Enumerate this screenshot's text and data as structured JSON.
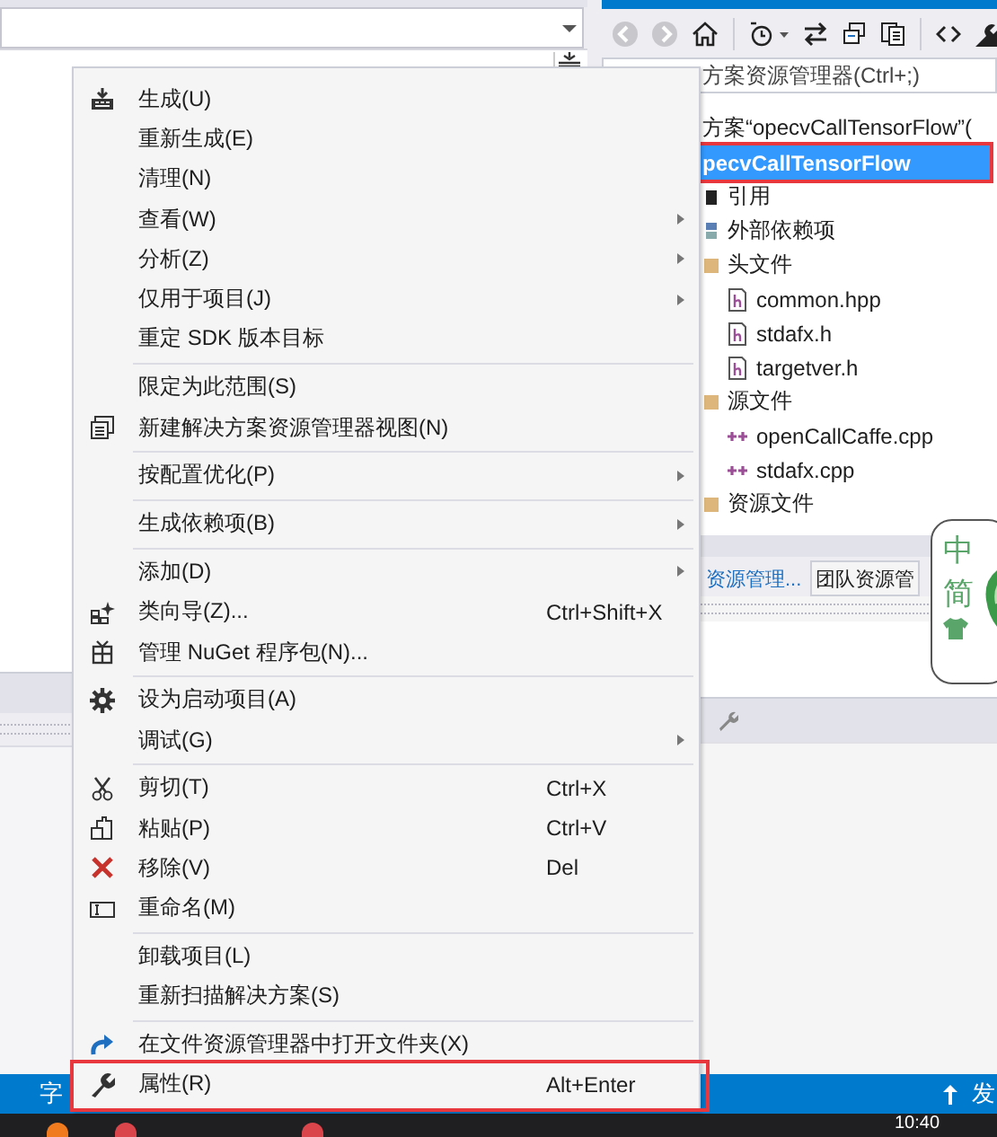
{
  "solution_explorer": {
    "search": {
      "placeholder": "方案资源管理器(Ctrl+;)"
    },
    "tree": [
      {
        "label": "方案“opecvCallTensorFlow”(",
        "selected": false,
        "children": [
          {
            "label": "pecvCallTensorFlow",
            "selected": true,
            "outlined": true,
            "children": [
              {
                "label": "引用",
                "kind": "references",
                "selected": false
              },
              {
                "label": "外部依赖项",
                "kind": "external",
                "selected": false
              },
              {
                "label": "头文件",
                "kind": "folder",
                "selected": false,
                "children": [
                  {
                    "label": "common.hpp",
                    "kind": "header",
                    "selected": false
                  },
                  {
                    "label": "stdafx.h",
                    "kind": "header",
                    "selected": false
                  },
                  {
                    "label": "targetver.h",
                    "kind": "header",
                    "selected": false
                  }
                ]
              },
              {
                "label": "源文件",
                "kind": "folder",
                "selected": false,
                "children": [
                  {
                    "label": "openCallCaffe.cpp",
                    "kind": "source",
                    "selected": false
                  },
                  {
                    "label": "stdafx.cpp",
                    "kind": "source",
                    "selected": false
                  }
                ]
              },
              {
                "label": "资源文件",
                "kind": "folder",
                "selected": false
              }
            ]
          }
        ]
      }
    ],
    "tabs": [
      {
        "label": "资源管理...",
        "selected": true
      },
      {
        "label": "团队资源管",
        "selected": false
      }
    ]
  },
  "ime_toolbar": {
    "items": [
      "中",
      "简"
    ]
  },
  "context_menu": {
    "items": [
      {
        "kind": "item",
        "label": "生成(U)"
      },
      {
        "kind": "item",
        "label": "重新生成(E)"
      },
      {
        "kind": "item",
        "label": "清理(N)"
      },
      {
        "kind": "item",
        "label": "查看(W)",
        "submenu": true
      },
      {
        "kind": "item",
        "label": "分析(Z)",
        "submenu": true
      },
      {
        "kind": "item",
        "label": "仅用于项目(J)",
        "submenu": true
      },
      {
        "kind": "item",
        "label": "重定 SDK 版本目标"
      },
      {
        "kind": "separator"
      },
      {
        "kind": "item",
        "label": "限定为此范围(S)"
      },
      {
        "kind": "item",
        "label": "新建解决方案资源管理器视图(N)"
      },
      {
        "kind": "separator"
      },
      {
        "kind": "item",
        "label": "按配置优化(P)",
        "submenu": true
      },
      {
        "kind": "separator"
      },
      {
        "kind": "item",
        "label": "生成依赖项(B)",
        "submenu": true
      },
      {
        "kind": "separator"
      },
      {
        "kind": "item",
        "label": "添加(D)",
        "submenu": true
      },
      {
        "kind": "item",
        "label": "类向导(Z)...",
        "shortcut": "Ctrl+Shift+X"
      },
      {
        "kind": "item",
        "label": "管理 NuGet 程序包(N)..."
      },
      {
        "kind": "separator"
      },
      {
        "kind": "item",
        "label": "设为启动项目(A)"
      },
      {
        "kind": "item",
        "label": "调试(G)",
        "submenu": true
      },
      {
        "kind": "separator"
      },
      {
        "kind": "item",
        "label": "剪切(T)",
        "shortcut": "Ctrl+X"
      },
      {
        "kind": "item",
        "label": "粘贴(P)",
        "shortcut": "Ctrl+V"
      },
      {
        "kind": "item",
        "label": "移除(V)",
        "shortcut": "Del"
      },
      {
        "kind": "item",
        "label": "重命名(M)"
      },
      {
        "kind": "separator"
      },
      {
        "kind": "item",
        "label": "卸载项目(L)"
      },
      {
        "kind": "item",
        "label": "重新扫描解决方案(S)"
      },
      {
        "kind": "separator"
      },
      {
        "kind": "item",
        "label": "在文件资源管理器中打开文件夹(X)"
      },
      {
        "kind": "item",
        "label": "属性(R)",
        "shortcut": "Alt+Enter",
        "outlined": true
      }
    ]
  },
  "status_bar": {
    "left": "字",
    "right": "发"
  },
  "taskbar": {
    "clock": "10:40"
  }
}
